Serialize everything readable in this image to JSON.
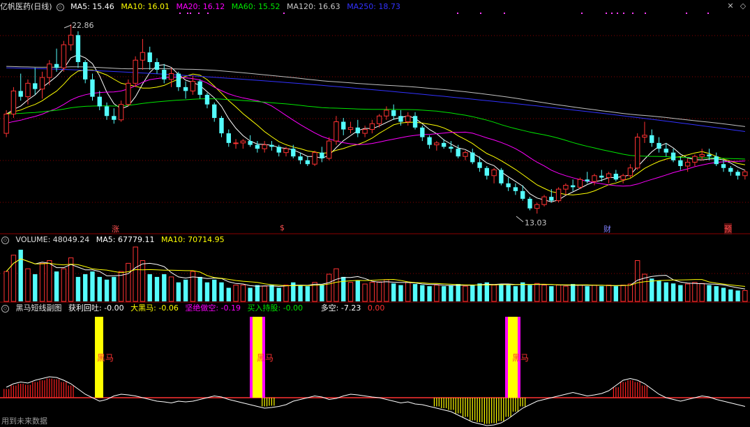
{
  "main_legend": {
    "title": "亿帆医药(日线)",
    "ma5": "MA5: 15.46",
    "ma10": "MA10: 16.01",
    "ma20": "MA20: 16.12",
    "ma60": "MA60: 15.52",
    "ma120": "MA120: 16.63",
    "ma250": "MA250: 18.73"
  },
  "price_annotations": {
    "high": "22.86",
    "low": "13.03"
  },
  "event_markers": [
    "涨",
    "$",
    "财",
    "预"
  ],
  "volume_legend": {
    "title": "VOLUME: 48049.24",
    "ma5": "MA5: 67779.11",
    "ma10": "MA10: 70714.95"
  },
  "indicator_legend": {
    "title": "黑马短线副图",
    "huoli": "获利回吐: -0.00",
    "daheima": "大黑马: -0.06",
    "jianjue": "坚绝做空: -0.19",
    "mairu": "买入持股: -0.00",
    "duokong": "多空: -7.23",
    "extra": "0.00"
  },
  "heima_label": "黑马",
  "footer": "用到未来数据",
  "colors": {
    "up": "#ff3232",
    "down": "#54fcfc",
    "ma5": "#ffffff",
    "ma10": "#ffff00",
    "ma20": "#ff00ff",
    "ma60": "#00e600",
    "ma120": "#c0c0c0",
    "ma250": "#3232ff",
    "grid": "#8b0000",
    "yellow": "#ffff00",
    "magenta": "#ff00ff"
  },
  "chart_data": {
    "type": "candlestick",
    "price_high": 22.86,
    "price_low": 13.03,
    "candles": [
      [
        17.2,
        18.4,
        17.0,
        18.2
      ],
      [
        18.2,
        19.6,
        18.0,
        19.4
      ],
      [
        19.4,
        20.3,
        18.9,
        19.1
      ],
      [
        19.1,
        20.0,
        18.7,
        19.8
      ],
      [
        19.8,
        20.6,
        19.2,
        19.5
      ],
      [
        19.5,
        20.4,
        19.0,
        20.1
      ],
      [
        20.1,
        21.0,
        19.7,
        20.8
      ],
      [
        20.8,
        21.6,
        20.4,
        20.6
      ],
      [
        20.6,
        22.0,
        20.4,
        21.8
      ],
      [
        21.8,
        22.86,
        21.5,
        22.3
      ],
      [
        22.3,
        22.5,
        20.6,
        20.9
      ],
      [
        20.9,
        21.0,
        19.8,
        20.0
      ],
      [
        20.0,
        20.3,
        18.9,
        19.1
      ],
      [
        19.1,
        19.4,
        18.4,
        18.6
      ],
      [
        18.6,
        18.8,
        17.9,
        18.1
      ],
      [
        18.1,
        18.5,
        17.7,
        17.9
      ],
      [
        17.9,
        18.9,
        17.8,
        18.7
      ],
      [
        18.7,
        20.0,
        18.6,
        19.8
      ],
      [
        19.8,
        21.2,
        19.6,
        21.0
      ],
      [
        21.0,
        22.1,
        20.5,
        21.4
      ],
      [
        21.4,
        21.7,
        20.5,
        20.9
      ],
      [
        20.9,
        21.1,
        20.3,
        20.5
      ],
      [
        20.5,
        20.8,
        19.8,
        20.0
      ],
      [
        20.0,
        20.6,
        19.6,
        20.3
      ],
      [
        20.3,
        20.4,
        19.4,
        19.6
      ],
      [
        19.6,
        19.9,
        19.0,
        19.4
      ],
      [
        19.4,
        20.2,
        19.2,
        19.9
      ],
      [
        19.9,
        20.0,
        19.0,
        19.2
      ],
      [
        19.2,
        19.3,
        18.5,
        18.7
      ],
      [
        18.7,
        18.8,
        17.8,
        18.0
      ],
      [
        18.0,
        18.1,
        17.0,
        17.2
      ],
      [
        17.2,
        17.4,
        16.5,
        16.7
      ],
      [
        16.7,
        16.9,
        16.4,
        16.7
      ],
      [
        16.7,
        16.9,
        16.4,
        16.8
      ],
      [
        16.8,
        17.1,
        16.5,
        16.6
      ],
      [
        16.6,
        16.8,
        16.2,
        16.4
      ],
      [
        16.4,
        16.8,
        16.2,
        16.6
      ],
      [
        16.6,
        16.8,
        16.3,
        16.5
      ],
      [
        16.5,
        16.6,
        16.0,
        16.2
      ],
      [
        16.2,
        16.5,
        16.0,
        16.4
      ],
      [
        16.4,
        16.6,
        15.9,
        16.0
      ],
      [
        16.0,
        16.2,
        15.6,
        15.8
      ],
      [
        15.8,
        16.0,
        15.5,
        15.6
      ],
      [
        15.6,
        16.3,
        15.5,
        16.2
      ],
      [
        16.2,
        16.5,
        15.7,
        15.9
      ],
      [
        15.9,
        17.0,
        15.8,
        16.8
      ],
      [
        16.8,
        18.1,
        16.6,
        17.8
      ],
      [
        17.8,
        18.0,
        17.1,
        17.4
      ],
      [
        17.4,
        17.8,
        17.2,
        17.5
      ],
      [
        17.5,
        17.9,
        17.0,
        17.2
      ],
      [
        17.2,
        17.6,
        17.0,
        17.4
      ],
      [
        17.4,
        17.9,
        17.2,
        17.7
      ],
      [
        17.7,
        18.2,
        17.5,
        18.1
      ],
      [
        18.1,
        18.6,
        17.9,
        18.4
      ],
      [
        18.4,
        18.7,
        17.9,
        18.1
      ],
      [
        18.1,
        18.4,
        17.6,
        17.8
      ],
      [
        17.8,
        18.3,
        17.6,
        18.1
      ],
      [
        18.1,
        18.3,
        17.4,
        17.5
      ],
      [
        17.5,
        17.6,
        16.8,
        17.0
      ],
      [
        17.0,
        17.1,
        16.4,
        16.6
      ],
      [
        16.6,
        16.8,
        16.3,
        16.7
      ],
      [
        16.7,
        16.9,
        16.4,
        16.5
      ],
      [
        16.5,
        16.8,
        16.2,
        16.4
      ],
      [
        16.4,
        16.6,
        15.9,
        16.0
      ],
      [
        16.0,
        16.3,
        15.8,
        16.2
      ],
      [
        16.2,
        16.4,
        15.6,
        15.7
      ],
      [
        15.7,
        16.0,
        15.2,
        15.4
      ],
      [
        15.4,
        15.5,
        14.8,
        15.0
      ],
      [
        15.0,
        15.4,
        14.6,
        15.3
      ],
      [
        15.3,
        15.4,
        14.5,
        14.6
      ],
      [
        14.6,
        14.9,
        14.2,
        14.4
      ],
      [
        14.4,
        14.6,
        14.0,
        14.2
      ],
      [
        14.2,
        14.5,
        13.7,
        13.8
      ],
      [
        13.8,
        13.9,
        13.2,
        13.3
      ],
      [
        13.3,
        13.6,
        13.03,
        13.5
      ],
      [
        13.5,
        14.0,
        13.4,
        13.9
      ],
      [
        13.9,
        14.3,
        13.6,
        13.7
      ],
      [
        13.7,
        14.4,
        13.6,
        14.3
      ],
      [
        14.3,
        14.6,
        14.0,
        14.5
      ],
      [
        14.5,
        14.8,
        14.2,
        14.4
      ],
      [
        14.4,
        14.9,
        14.3,
        14.8
      ],
      [
        14.8,
        15.2,
        14.6,
        14.7
      ],
      [
        14.7,
        15.1,
        14.5,
        15.0
      ],
      [
        15.0,
        15.3,
        14.7,
        14.9
      ],
      [
        14.9,
        15.2,
        14.6,
        15.1
      ],
      [
        15.1,
        15.3,
        14.7,
        14.8
      ],
      [
        14.8,
        15.1,
        14.6,
        15.0
      ],
      [
        15.0,
        15.6,
        14.9,
        15.4
      ],
      [
        15.4,
        17.2,
        15.3,
        17.0
      ],
      [
        17.0,
        17.8,
        16.7,
        17.1
      ],
      [
        17.1,
        17.4,
        16.5,
        16.7
      ],
      [
        16.7,
        17.0,
        16.2,
        16.4
      ],
      [
        16.4,
        16.7,
        16.0,
        16.2
      ],
      [
        16.2,
        16.4,
        15.7,
        15.8
      ],
      [
        15.8,
        16.0,
        15.3,
        15.5
      ],
      [
        15.5,
        15.9,
        15.2,
        15.7
      ],
      [
        15.7,
        16.1,
        15.5,
        16.0
      ],
      [
        16.0,
        16.4,
        15.8,
        16.1
      ],
      [
        16.1,
        16.4,
        15.8,
        16.0
      ],
      [
        16.0,
        16.2,
        15.5,
        15.6
      ],
      [
        15.6,
        15.8,
        15.2,
        15.4
      ],
      [
        15.4,
        15.5,
        15.0,
        15.2
      ],
      [
        15.2,
        15.3,
        14.8,
        15.0
      ],
      [
        15.0,
        15.3,
        14.8,
        15.2
      ]
    ],
    "volumes": [
      0.55,
      0.85,
      0.95,
      0.6,
      0.5,
      0.7,
      0.75,
      0.55,
      0.6,
      0.8,
      0.45,
      0.5,
      0.55,
      0.45,
      0.4,
      0.45,
      0.55,
      0.7,
      1.0,
      0.75,
      0.5,
      0.45,
      0.5,
      0.45,
      0.35,
      0.4,
      0.55,
      0.45,
      0.35,
      0.4,
      0.35,
      0.25,
      0.3,
      0.3,
      0.25,
      0.3,
      0.28,
      0.3,
      0.25,
      0.3,
      0.35,
      0.3,
      0.28,
      0.35,
      0.3,
      0.5,
      0.6,
      0.45,
      0.35,
      0.38,
      0.32,
      0.35,
      0.36,
      0.4,
      0.33,
      0.3,
      0.35,
      0.32,
      0.3,
      0.28,
      0.3,
      0.28,
      0.3,
      0.32,
      0.28,
      0.3,
      0.33,
      0.35,
      0.3,
      0.32,
      0.3,
      0.28,
      0.35,
      0.3,
      0.33,
      0.3,
      0.28,
      0.3,
      0.28,
      0.32,
      0.3,
      0.28,
      0.3,
      0.28,
      0.3,
      0.28,
      0.3,
      0.32,
      0.75,
      0.5,
      0.42,
      0.38,
      0.35,
      0.33,
      0.3,
      0.32,
      0.35,
      0.33,
      0.3,
      0.28,
      0.25,
      0.22,
      0.2,
      0.2
    ],
    "duokong": [
      0.3,
      0.4,
      0.45,
      0.42,
      0.5,
      0.55,
      0.6,
      0.58,
      0.5,
      0.4,
      0.25,
      0.1,
      0.0,
      -0.1,
      -0.05,
      0.05,
      0.1,
      0.08,
      0.05,
      0.0,
      -0.05,
      -0.1,
      -0.12,
      -0.15,
      -0.1,
      -0.12,
      -0.1,
      -0.05,
      0.0,
      0.05,
      0.02,
      -0.05,
      -0.1,
      -0.15,
      -0.2,
      -0.25,
      -0.3,
      -0.28,
      -0.25,
      -0.2,
      -0.1,
      -0.05,
      0.0,
      0.05,
      0.02,
      -0.05,
      -0.02,
      0.05,
      0.1,
      0.08,
      0.05,
      0.02,
      0.0,
      -0.05,
      -0.1,
      -0.15,
      -0.12,
      -0.18,
      -0.2,
      -0.25,
      -0.3,
      -0.35,
      -0.4,
      -0.5,
      -0.6,
      -0.7,
      -0.75,
      -0.8,
      -0.78,
      -0.72,
      -0.6,
      -0.45,
      -0.3,
      -0.2,
      -0.1,
      -0.05,
      0.0,
      0.05,
      0.1,
      0.15,
      0.1,
      0.05,
      0.08,
      0.12,
      0.2,
      0.35,
      0.5,
      0.55,
      0.5,
      0.4,
      0.25,
      0.1,
      0.0,
      -0.05,
      -0.1,
      -0.05,
      0.0,
      0.05,
      0.02,
      -0.05,
      -0.1,
      -0.15,
      -0.2,
      -0.25
    ]
  }
}
